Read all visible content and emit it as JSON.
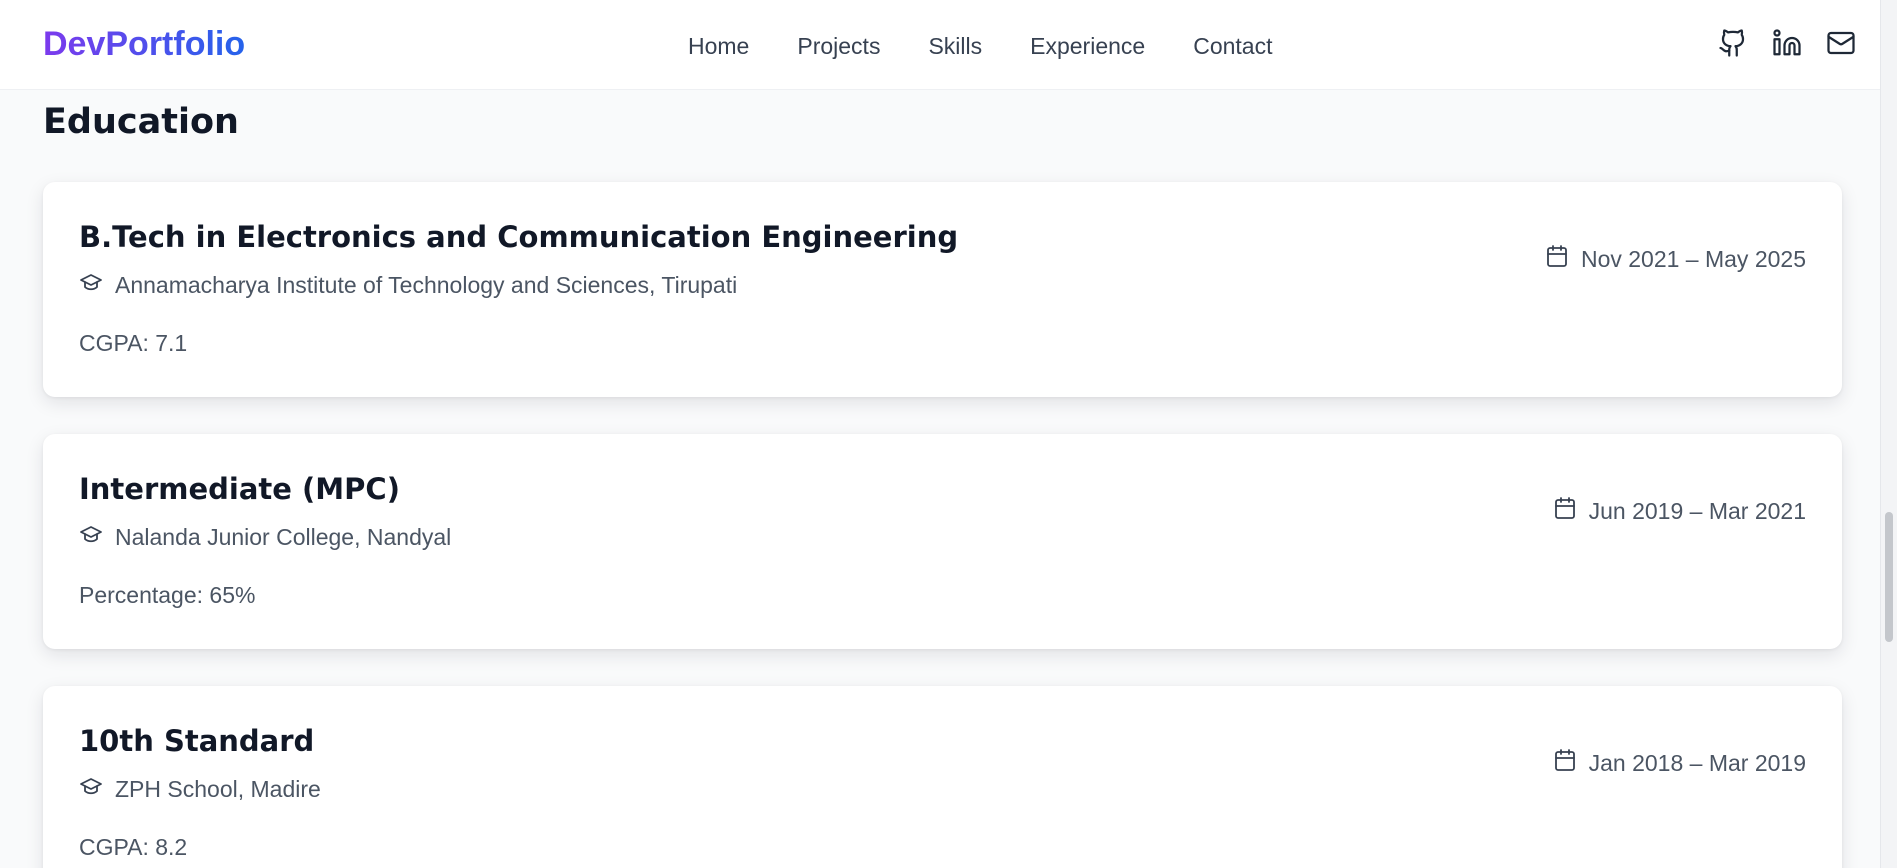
{
  "header": {
    "logo": "DevPortfolio",
    "nav": [
      "Home",
      "Projects",
      "Skills",
      "Experience",
      "Contact"
    ],
    "social_icons": [
      "github-icon",
      "linkedin-icon",
      "mail-icon"
    ]
  },
  "education": {
    "title": "Education",
    "items": [
      {
        "degree": "B.Tech in Electronics and Communication Engineering",
        "institution": "Annamacharya Institute of Technology and Sciences, Tirupati",
        "score": "CGPA: 7.1",
        "dates": "Nov 2021 – May 2025"
      },
      {
        "degree": "Intermediate (MPC)",
        "institution": "Nalanda Junior College, Nandyal",
        "score": "Percentage: 65%",
        "dates": "Jun 2019 – Mar 2021"
      },
      {
        "degree": "10th Standard",
        "institution": "ZPH School, Madire",
        "score": "CGPA: 8.2",
        "dates": "Jan 2018 – Mar 2019"
      }
    ]
  },
  "colors": {
    "logo_gradient_start": "#7c3aed",
    "logo_gradient_end": "#2563eb",
    "text_primary": "#111827",
    "text_secondary": "#4b5563",
    "background": "#f9fafb"
  }
}
